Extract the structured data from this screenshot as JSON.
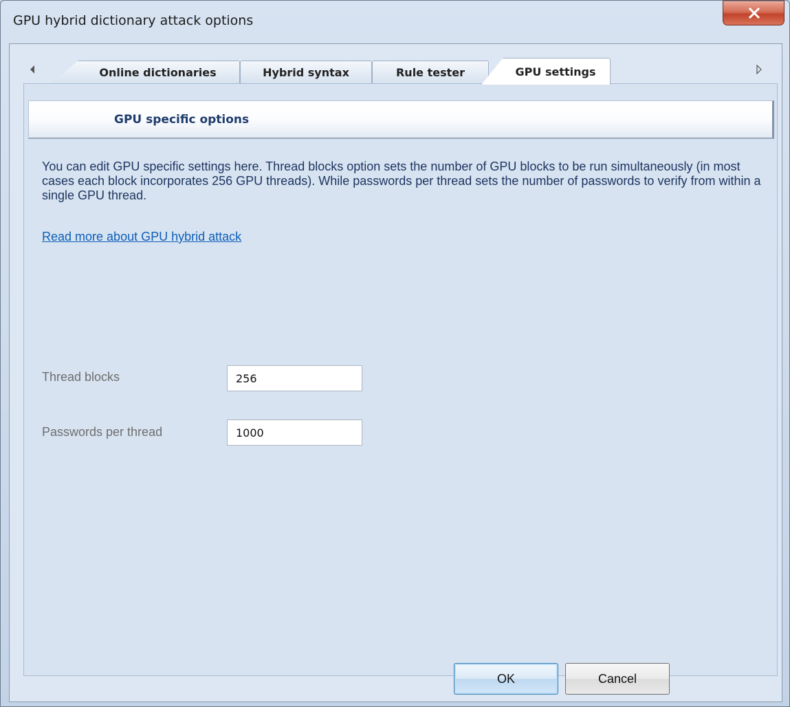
{
  "window": {
    "title": "GPU hybrid dictionary attack options"
  },
  "tabs": [
    {
      "label": "Online dictionaries"
    },
    {
      "label": "Hybrid syntax"
    },
    {
      "label": "Rule tester"
    },
    {
      "label": "GPU settings",
      "active": true
    }
  ],
  "icons": {
    "close": "close-icon",
    "prev": "scroll-left-icon",
    "next": "scroll-right-icon"
  },
  "section": {
    "title": "GPU specific options",
    "description": "You can edit GPU specific settings here. Thread blocks option sets the number of GPU blocks to be run simultaneously (in most cases each block incorporates 256 GPU threads). While passwords per thread sets the number of passwords to verify from within a single GPU thread.",
    "link": "Read more about GPU hybrid attack"
  },
  "fields": {
    "thread_blocks": {
      "label": "Thread blocks",
      "value": "256"
    },
    "passwords_per_thread": {
      "label": "Passwords per thread",
      "value": "1000"
    }
  },
  "buttons": {
    "ok": "OK",
    "cancel": "Cancel"
  },
  "colors": {
    "accent": "#1f3c6c",
    "link": "#0f5fb8",
    "close": "#c2442b"
  }
}
